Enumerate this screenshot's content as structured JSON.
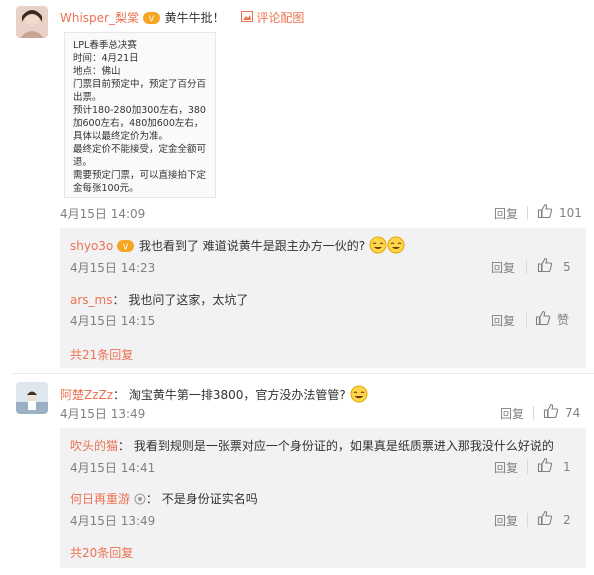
{
  "comment1": {
    "username": "Whisper_梨棠",
    "text": "黄牛牛批！",
    "pic_link": "评论配图",
    "time": "4月15日 14:09",
    "reply_label": "回复",
    "likes": "101",
    "card_lines": [
      "LPL春季总决赛",
      "时间：4月21日",
      "地点：佛山",
      "门票目前预定中，预定了百分百出票。",
      "预计180-280加300左右，380加600左右，480加600左右，具体以最终定价为准。",
      "最终定价不能接受，定金全额可退。",
      "需要预定门票，可以直接拍下定金每张100元。"
    ]
  },
  "replies1": [
    {
      "username": "shyo3o",
      "text": "我也看到了 难道说黄牛是跟主办方一伙的?",
      "time": "4月15日 14:23",
      "reply_label": "回复",
      "likes": "5"
    },
    {
      "username": "ars_ms",
      "text": "我也问了这家，太坑了",
      "time": "4月15日 14:15",
      "reply_label": "回复",
      "likes": "赞"
    }
  ],
  "more1": "共21条回复",
  "comment2": {
    "username": "阿楚ZzZz",
    "text": "淘宝黄牛第一排3800，官方没办法管管?",
    "time": "4月15日 13:49",
    "reply_label": "回复",
    "likes": "74"
  },
  "replies2": [
    {
      "username": "吹头的猫",
      "text": "我看到规则是一张票对应一个身份证的，如果真是纸质票进入那我没什么好说的",
      "time": "4月15日 14:41",
      "reply_label": "回复",
      "likes": "1"
    },
    {
      "username": "何日再重游",
      "text": "不是身份证实名吗",
      "time": "4月15日 13:49",
      "reply_label": "回复",
      "likes": "2"
    }
  ],
  "more2": "共20条回复",
  "colors": {
    "link": "#eb7350",
    "meta": "#808080",
    "reply_bg": "#f2f2f5"
  }
}
